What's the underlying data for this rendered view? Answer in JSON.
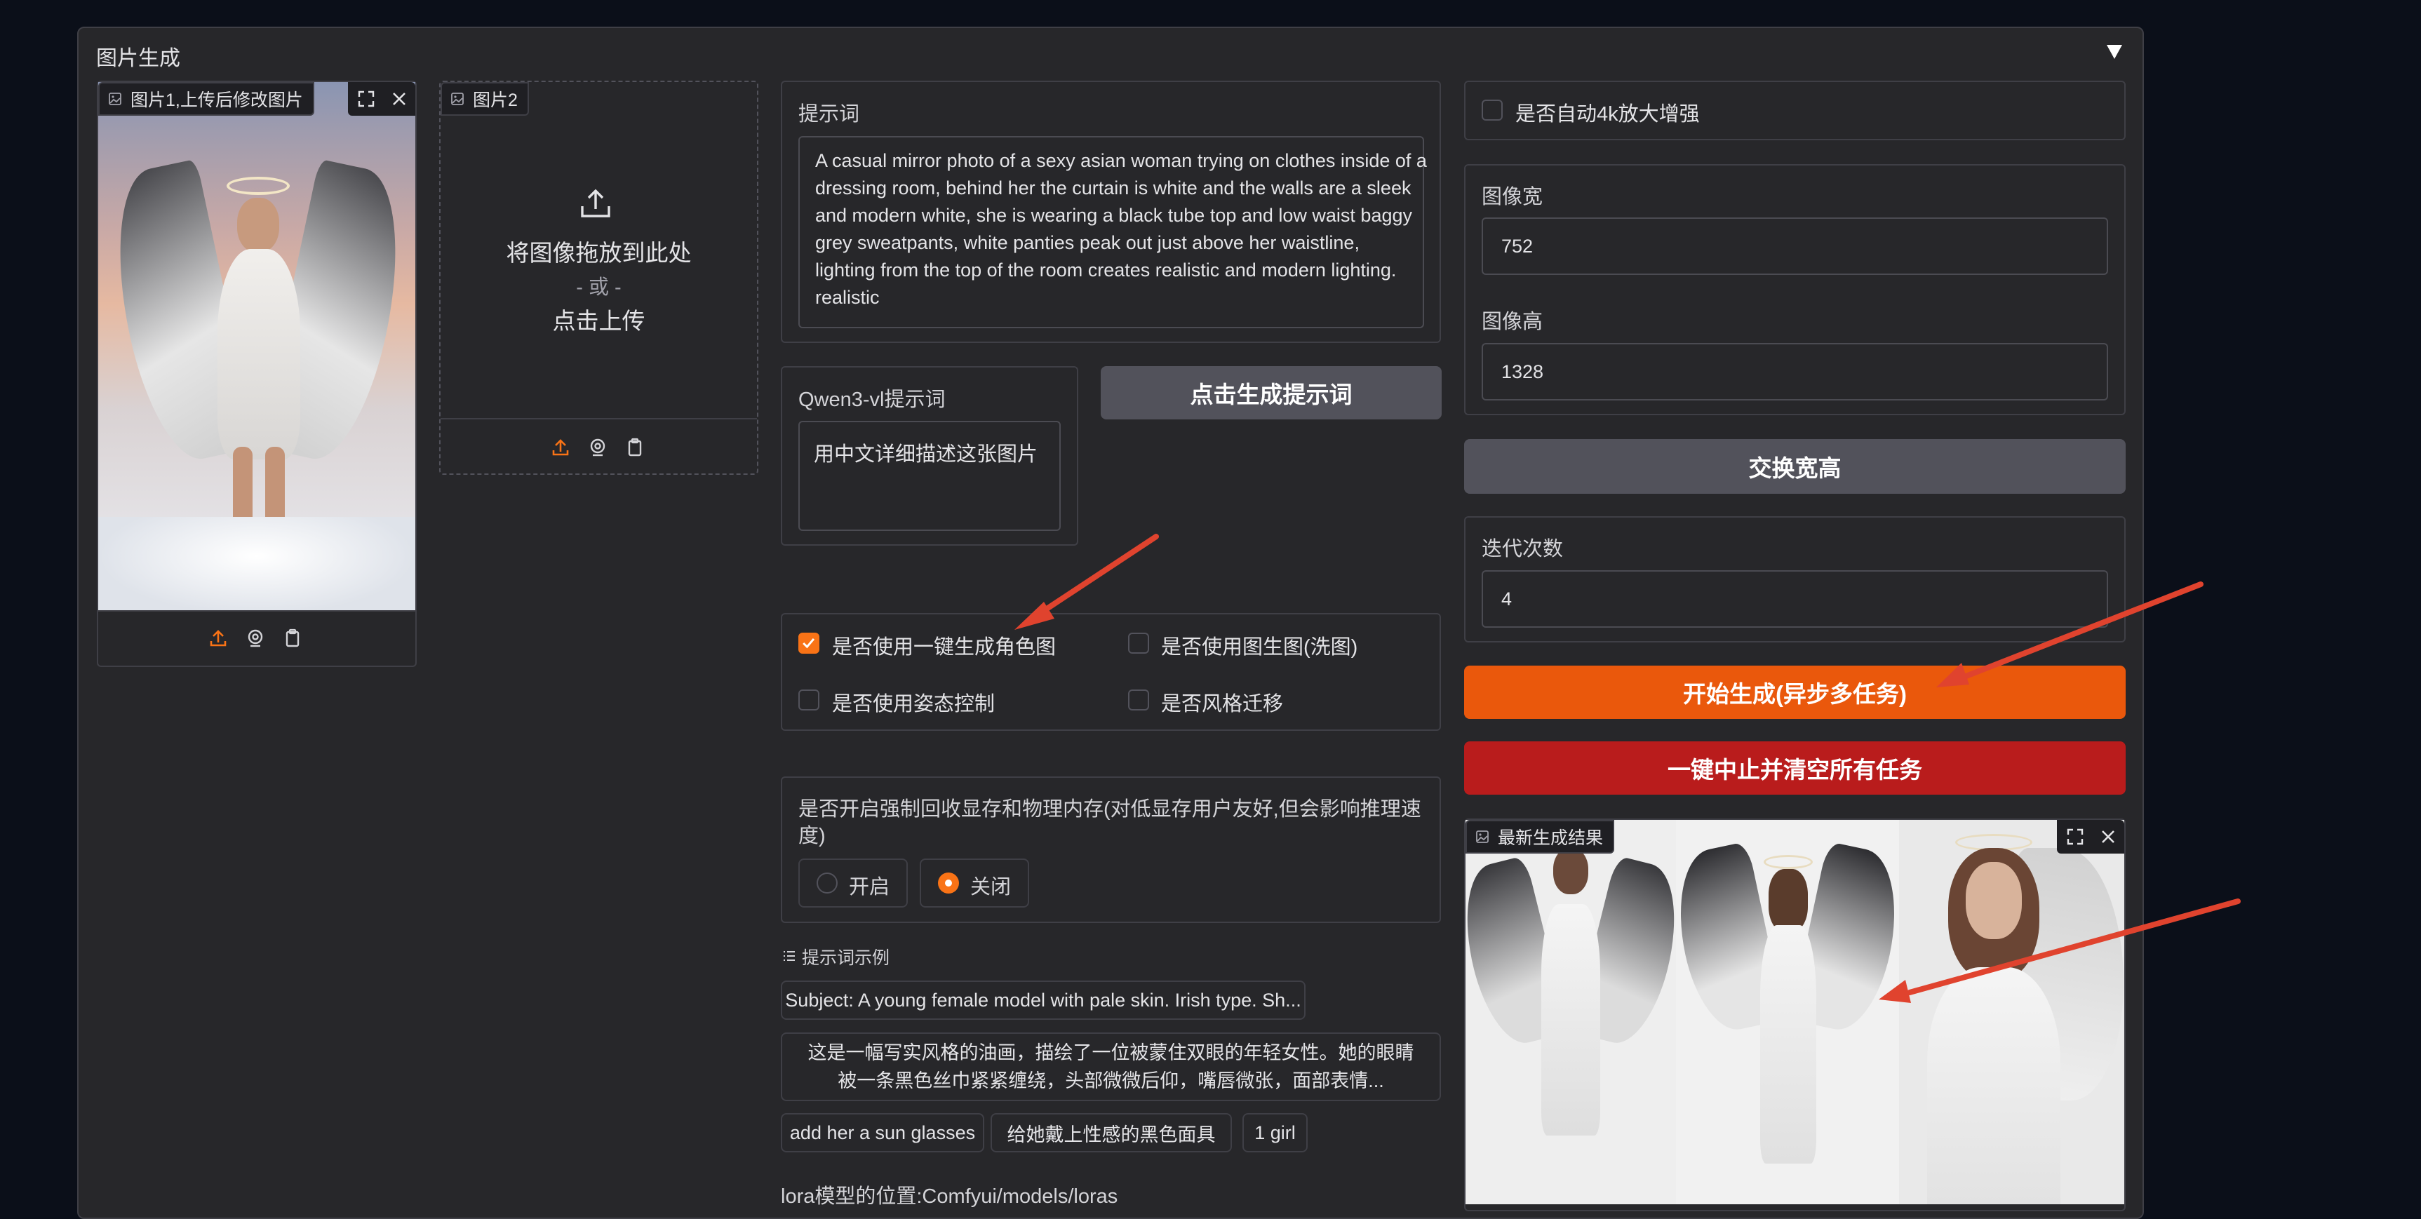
{
  "panel": {
    "title": "图片生成",
    "collapse_icon": "triangle-down-icon"
  },
  "image1": {
    "label": "图片1,上传后修改图片",
    "icons": [
      "fullscreen-icon",
      "close-icon",
      "upload-icon",
      "webcam-icon",
      "clipboard-icon"
    ]
  },
  "image2": {
    "label": "图片2",
    "drop_text": "将图像拖放到此处",
    "or_text": "- 或 -",
    "click_text": "点击上传"
  },
  "prompt": {
    "label": "提示词",
    "value": "A casual mirror photo of a sexy asian woman trying on clothes inside of a dressing room, behind her the curtain is white and the walls are a sleek and modern white, she is wearing a black tube top and low waist baggy grey sweatpants, white panties peak out just above her waistline, lighting from the top of the room creates realistic and modern lighting. realistic",
    "lines": [
      "A casual mirror photo of a sexy asian woman trying on clothes inside of a",
      "dressing room, behind her the curtain is white and the walls are a sleek",
      "and modern white, she is wearing a black tube top and low waist baggy",
      "grey sweatpants, white panties peak out just above her waistline,",
      "lighting from the top of the room creates realistic and modern lighting.",
      "realistic"
    ]
  },
  "qwen": {
    "label": "Qwen3-vl提示词",
    "value": "用中文详细描述这张图片"
  },
  "gen_prompt_button": "点击生成提示词",
  "options": [
    {
      "label": "是否使用一键生成角色图",
      "checked": true
    },
    {
      "label": "是否使用图生图(洗图)",
      "checked": false
    },
    {
      "label": "是否使用姿态控制",
      "checked": false
    },
    {
      "label": "是否风格迁移",
      "checked": false
    }
  ],
  "memory": {
    "label_line1": "是否开启强制回收显存和物理内存(对低显存用户友好,但会影响推理速",
    "label_line2": "度)",
    "on": "开启",
    "off": "关闭",
    "selected": "关闭"
  },
  "examples": {
    "title": "提示词示例",
    "items": [
      "Subject: A young female model with pale skin. Irish type. Sh...",
      "这是一幅写实风格的油画，描绘了一位被蒙住双眼的年轻女性。她的眼睛",
      "被一条黑色丝巾紧紧缠绕，头部微微后仰，嘴唇微张，面部表情...",
      "add her a sun glasses",
      "给她戴上性感的黑色面具",
      "1 girl"
    ]
  },
  "lora_path": "lora模型的位置:Comfyui/models/loras",
  "upscale": {
    "label": "是否自动4k放大增强",
    "checked": false
  },
  "width": {
    "label": "图像宽",
    "value": "752"
  },
  "height": {
    "label": "图像高",
    "value": "1328"
  },
  "swap_button": "交换宽高",
  "steps": {
    "label": "迭代次数",
    "value": "4"
  },
  "start_button": "开始生成(异步多任务)",
  "stop_button": "一键中止并清空所有任务",
  "result": {
    "label": "最新生成结果"
  },
  "colors": {
    "accent": "#f97316",
    "start": "#ea580c",
    "stop": "#b91c1c",
    "panel": "#27272a",
    "bg": "#0b0f19",
    "arrow": "#e0432e"
  }
}
